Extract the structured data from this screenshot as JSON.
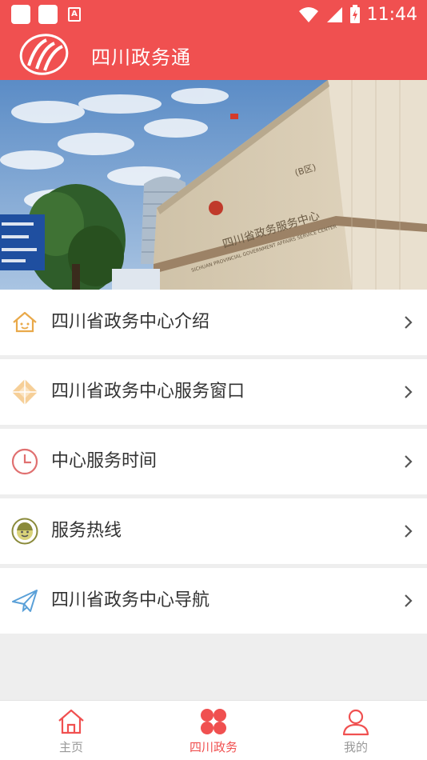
{
  "status_bar": {
    "time": "11:44"
  },
  "app_bar": {
    "title": "四川政务通"
  },
  "banner": {
    "sign_line": "四川省政务服务中心",
    "sign_sub": "(B区)",
    "sign_en": "SICHUAN PROVINCIAL GOVERNMENT AFFAIRS SERVICE CENTER"
  },
  "menu": {
    "items": [
      {
        "label": "四川省政务中心介绍",
        "icon": "house-icon"
      },
      {
        "label": "四川省政务中心服务窗口",
        "icon": "diamond-icon"
      },
      {
        "label": "中心服务时间",
        "icon": "clock-icon"
      },
      {
        "label": "服务热线",
        "icon": "service-face-icon"
      },
      {
        "label": "四川省政务中心导航",
        "icon": "paper-plane-icon"
      }
    ]
  },
  "tab_bar": {
    "tabs": [
      {
        "label": "主页",
        "icon": "home-icon",
        "active": false
      },
      {
        "label": "四川政务",
        "icon": "grid-icon",
        "active": true
      },
      {
        "label": "我的",
        "icon": "user-icon",
        "active": false
      }
    ]
  },
  "colors": {
    "brand": "#f05050",
    "text": "#333333",
    "inactive": "#999999",
    "background": "#eeeeee"
  }
}
